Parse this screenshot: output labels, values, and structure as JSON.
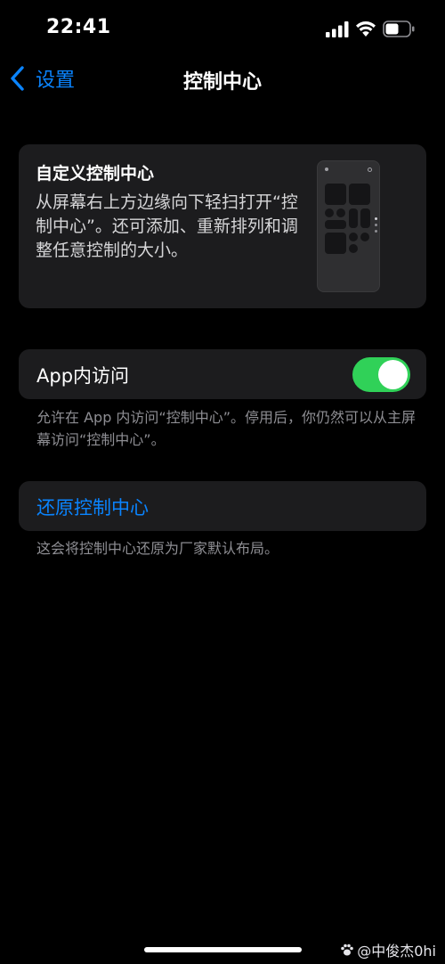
{
  "status_bar": {
    "time": "22:41",
    "icons": [
      "signal-icon",
      "wifi-icon",
      "battery-icon"
    ]
  },
  "nav": {
    "back_label": "设置",
    "title": "控制中心"
  },
  "hero": {
    "title": "自定义控制中心",
    "description": "从屏幕右上方边缘向下轻扫打开“控制中心”。还可添加、重新排列和调整任意控制的大小。",
    "preview_icon": "control-center-preview-icon"
  },
  "app_access": {
    "label": "App内访问",
    "enabled": true,
    "footnote": "允许在 App 内访问“控制中心”。停用后，你仍然可以从主屏幕访问“控制中心”。"
  },
  "reset": {
    "label": "还原控制中心",
    "footnote": "这会将控制中心还原为厂家默认布局。"
  },
  "watermark": {
    "text": "@中俊杰0hi"
  },
  "colors": {
    "background": "#000000",
    "card": "#1c1c1e",
    "accent": "#0a84ff",
    "toggle_on": "#30d158",
    "secondary_text": "#8e8e93"
  }
}
